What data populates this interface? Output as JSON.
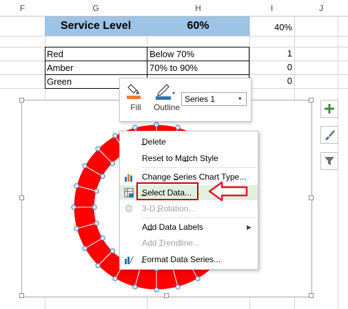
{
  "columns": {
    "f": "F",
    "g": "G",
    "h": "H",
    "i": "I",
    "j": "J"
  },
  "service": {
    "label": "Service Level",
    "value": "60%",
    "extra": "40%"
  },
  "legend_table": [
    {
      "name": "Red",
      "range": "Below 70%",
      "val": "1"
    },
    {
      "name": "Amber",
      "range": "70% to 90%",
      "val": "0"
    },
    {
      "name": "Green",
      "range": "",
      "val": "0"
    }
  ],
  "mini_toolbar": {
    "fill_label": "Fill",
    "outline_label": "Outline",
    "series_select": "Series 1"
  },
  "context_menu": {
    "items": [
      {
        "label": "Delete",
        "enabled": true
      },
      {
        "label": "Reset to Match Style",
        "enabled": true
      },
      {
        "label": "Change Series Chart Type...",
        "enabled": true
      },
      {
        "label": "Select Data...",
        "enabled": true
      },
      {
        "label": "3-D Rotation...",
        "enabled": false
      },
      {
        "label": "Add Data Labels",
        "enabled": true
      },
      {
        "label": "Add Trendline...",
        "enabled": false
      },
      {
        "label": "Format Data Series...",
        "enabled": true
      }
    ]
  },
  "chart_side_buttons": [
    "chart-elements-plus-icon",
    "chart-styles-brush-icon",
    "chart-filters-funnel-icon"
  ],
  "colors": {
    "header_blue": "#9dc3e6",
    "doughnut_red": "#ff0000",
    "highlight_green": "#e1f0e1",
    "arrow_red": "#e81123",
    "select_box": "#c00000"
  }
}
